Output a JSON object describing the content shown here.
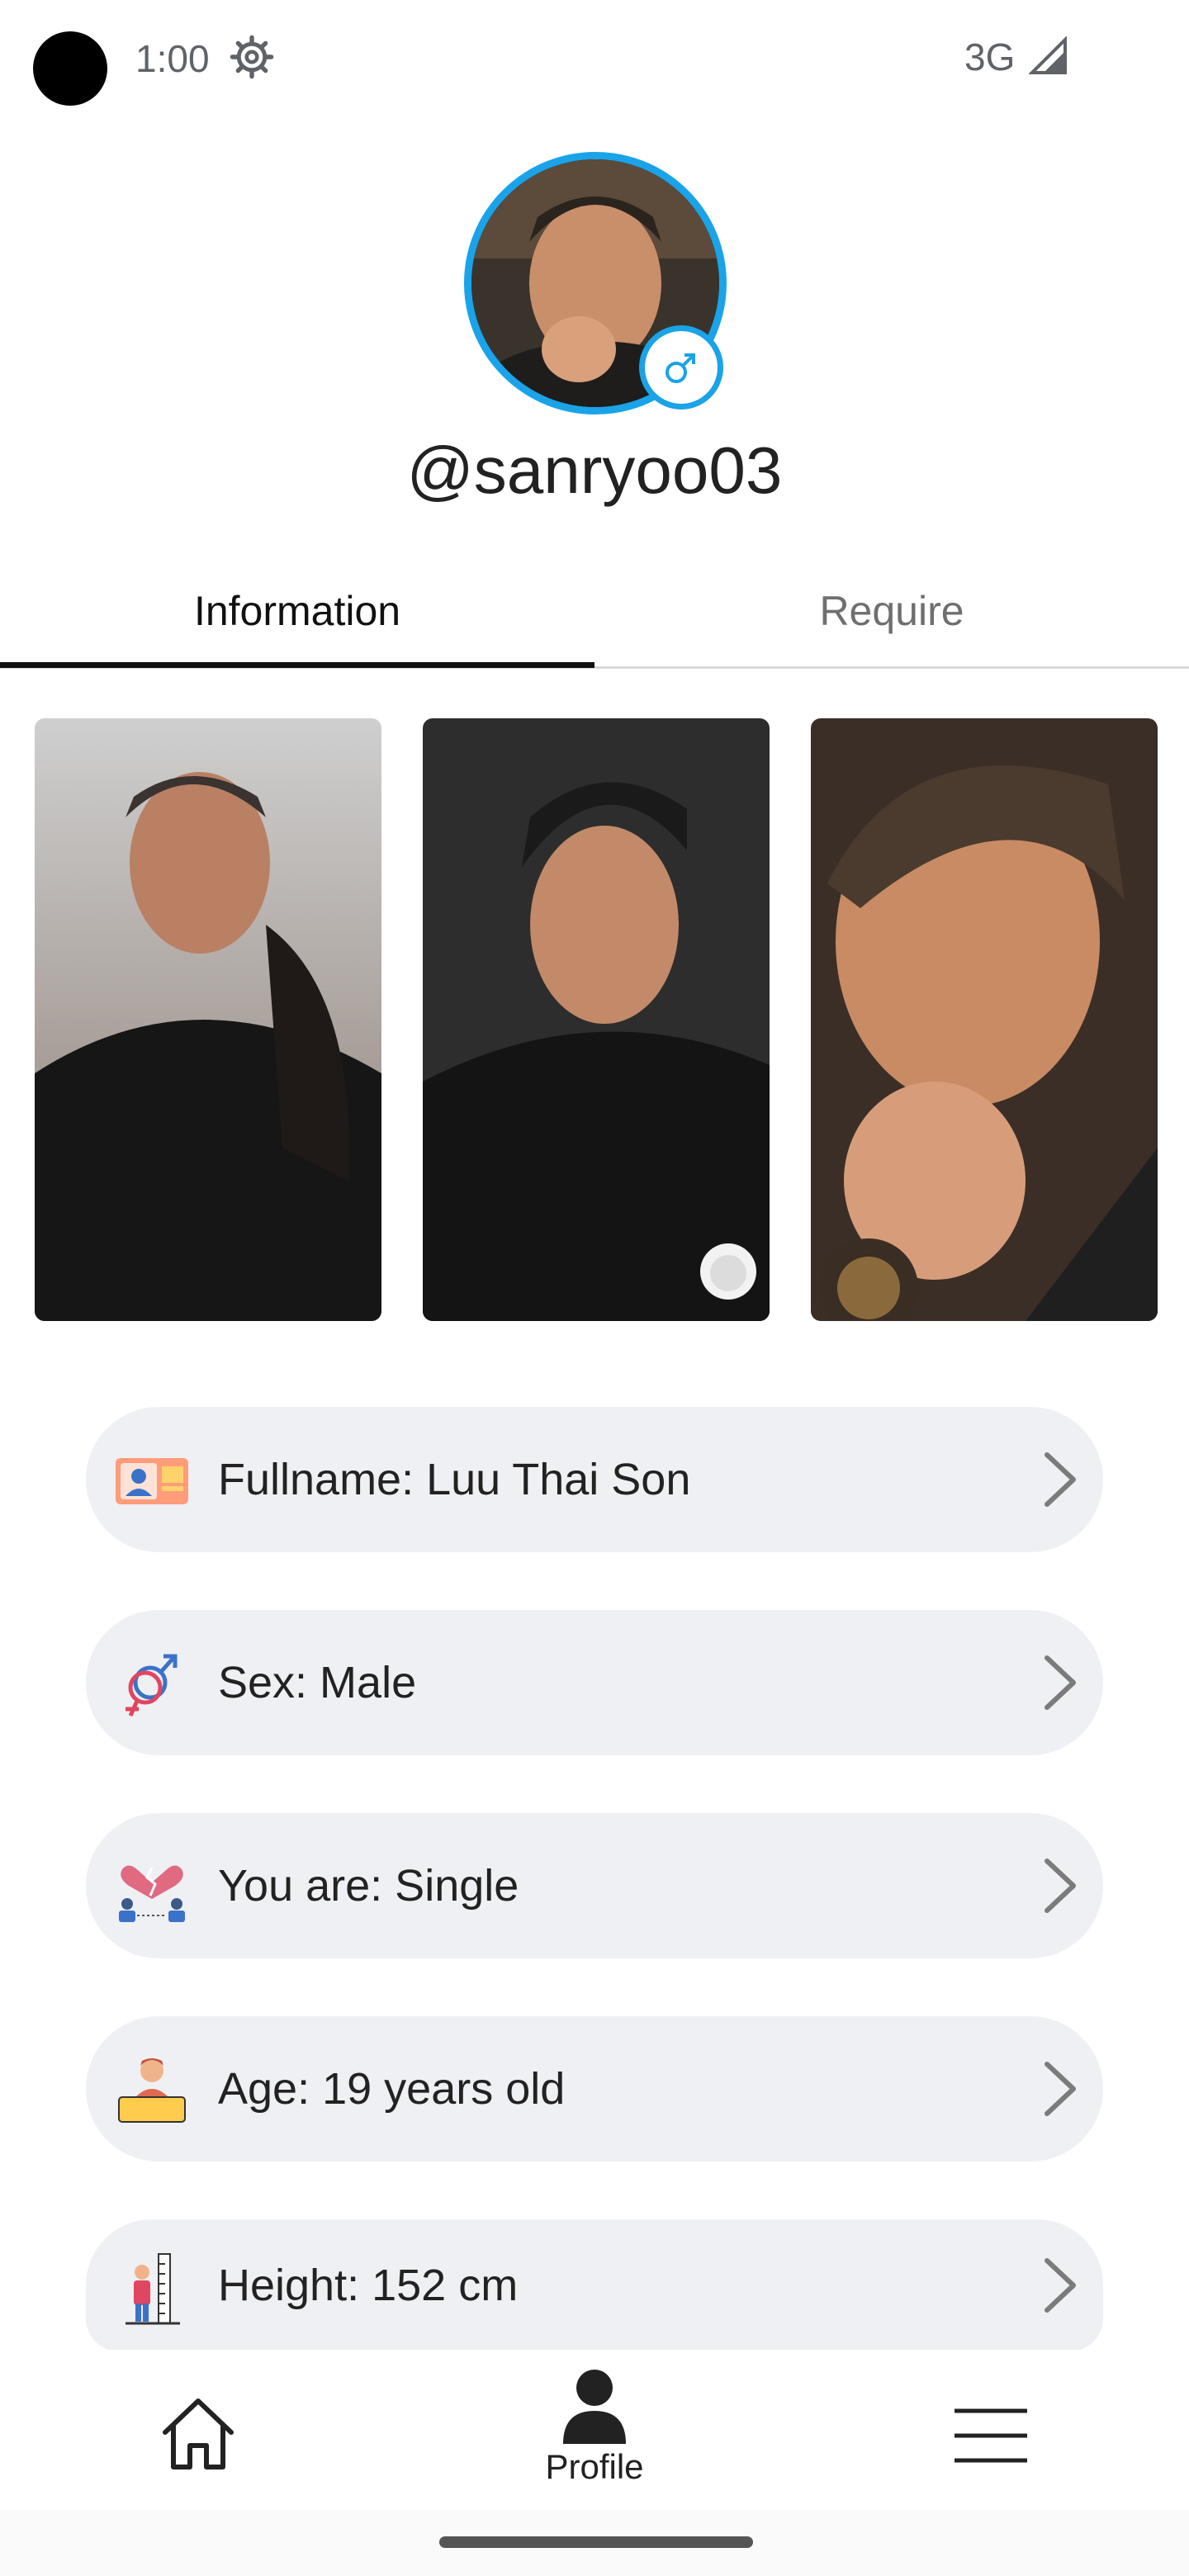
{
  "status_bar": {
    "time": "1:00",
    "network": "3G"
  },
  "profile": {
    "username": "@sanryoo03",
    "gender_symbol": "♂"
  },
  "tabs": [
    {
      "label": "Information",
      "selected": true
    },
    {
      "label": "Require",
      "selected": false
    }
  ],
  "info_rows": [
    {
      "label": "Fullname: Luu Thai Son",
      "icon": "id-card-icon"
    },
    {
      "label": "Sex: Male",
      "icon": "gender-symbols-icon"
    },
    {
      "label": "You are: Single",
      "icon": "broken-heart-couple-icon"
    },
    {
      "label": "Age: 19 years old",
      "icon": "age-badge-icon"
    },
    {
      "label": "Height: 152 cm",
      "icon": "height-measure-icon"
    }
  ],
  "bottom_nav": {
    "items": [
      {
        "label": "",
        "icon": "home-icon"
      },
      {
        "label": "Profile",
        "icon": "person-icon"
      },
      {
        "label": "",
        "icon": "menu-icon"
      }
    ]
  },
  "colors": {
    "accent": "#1aa3e8",
    "row_background": "#eff0f4",
    "tab_indicator": "#111111"
  }
}
